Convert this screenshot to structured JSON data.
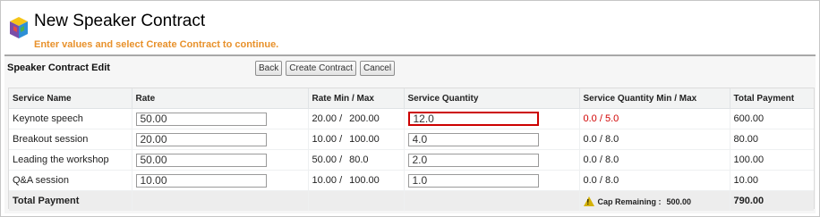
{
  "header": {
    "title": "New Speaker Contract",
    "instruction": "Enter values and select Create Contract to continue.",
    "logo_icon": "cube-logo-icon"
  },
  "section": {
    "title": "Speaker Contract Edit",
    "buttons": {
      "back": "Back",
      "create": "Create Contract",
      "cancel": "Cancel"
    }
  },
  "table": {
    "columns": [
      "Service Name",
      "Rate",
      "Rate Min / Max",
      "Service Quantity",
      "Service Quantity Min / Max",
      "Total Payment"
    ],
    "rows": [
      {
        "service": "Keynote speech",
        "rate": "50.00",
        "rate_min": "20.00 /",
        "rate_max": "200.00",
        "quantity": "12.0",
        "qty_minmax": "0.0 / 5.0",
        "total": "600.00",
        "error": true
      },
      {
        "service": "Breakout session",
        "rate": "20.00",
        "rate_min": "10.00 /",
        "rate_max": "100.00",
        "quantity": "4.0",
        "qty_minmax": "0.0 / 8.0",
        "total": "80.00",
        "error": false
      },
      {
        "service": "Leading the workshop",
        "rate": "50.00",
        "rate_min": "50.00 /",
        "rate_max": "80.0",
        "quantity": "2.0",
        "qty_minmax": "0.0 / 8.0",
        "total": "100.00",
        "error": false
      },
      {
        "service": "Q&A session",
        "rate": "10.00",
        "rate_min": "10.00 /",
        "rate_max": "100.00",
        "quantity": "1.0",
        "qty_minmax": "0.0 / 8.0",
        "total": "10.00",
        "error": false
      }
    ],
    "footer": {
      "label": "Total Payment",
      "cap_label": "Cap Remaining :",
      "cap_value": "500.00",
      "total": "790.00",
      "warning_icon": "warning-icon"
    }
  },
  "colors": {
    "instruction": "#e8912b",
    "error": "#d10000",
    "warning": "#d4b106"
  }
}
